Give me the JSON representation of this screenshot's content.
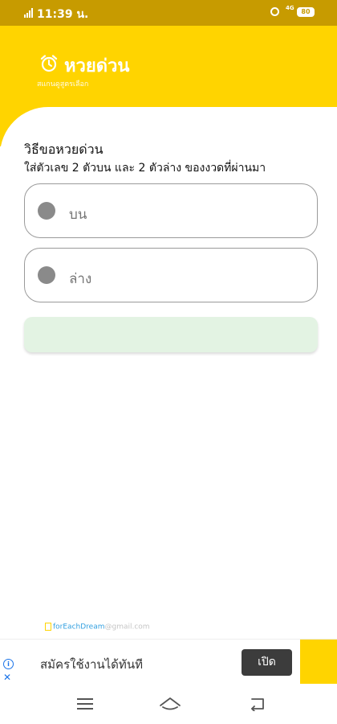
{
  "status_bar": {
    "time": "11:39 น.",
    "network": "4G",
    "battery": "80"
  },
  "header": {
    "title": "หวยด่วน",
    "subtitle": "สแกนดูสูตรเลือก"
  },
  "form": {
    "title": "วิธีขอหวยด่วน",
    "description": "ใส่ตัวเลข 2 ตัวบน และ 2 ตัวล่าง ของงวดที่ผ่านมา",
    "top_placeholder": "บน",
    "bottom_placeholder": "ล่าง",
    "submit_label": ""
  },
  "credit": {
    "part1": "forEachDream",
    "part2": "@gmail.com"
  },
  "ad": {
    "text": "สมัครใช้งานได้ทันที",
    "button_label": "เปิด"
  },
  "colors": {
    "primary": "#ffd400",
    "status_bar": "#c79b00",
    "submit_bg": "#e3f3e3",
    "ad_button": "#3c3c3c"
  }
}
